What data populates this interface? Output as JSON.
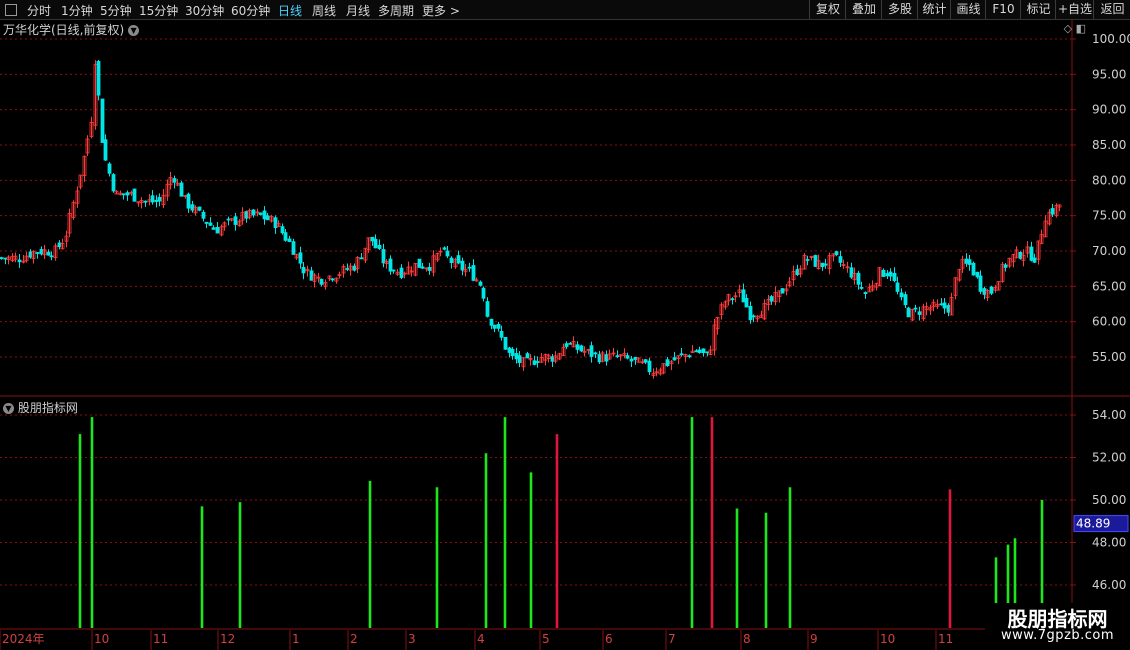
{
  "toolbar": {
    "left": [
      "分时",
      "1分钟",
      "5分钟",
      "15分钟",
      "30分钟",
      "60分钟",
      "日线",
      "周线",
      "月线",
      "多周期",
      "更多 >"
    ],
    "active": "日线",
    "right": [
      "复权",
      "叠加",
      "多股",
      "统计",
      "画线",
      "F10",
      "标记",
      "+自选",
      "返回"
    ]
  },
  "title": "万华化学(日线,前复权)",
  "indicator_title": "股朋指标网",
  "watermark": {
    "name": "股朋指标网",
    "url": "www.7gpzb.com"
  },
  "colors": {
    "up": "#ff3b3b",
    "down": "#00e5e5",
    "grid": "#8a1010",
    "bar_green": "#1ee61e",
    "bar_red": "#e0163c",
    "current_value_box": "#1a1a9a"
  },
  "chart_data": [
    {
      "type": "candlestick",
      "title": "万华化学(日线,前复权)",
      "ylim": [
        52,
        101
      ],
      "yticks": [
        "100.00",
        "95.00",
        "90.00",
        "85.00",
        "80.00",
        "75.00",
        "70.00",
        "65.00",
        "60.00",
        "55.00"
      ],
      "ytick_values": [
        100,
        95,
        90,
        85,
        80,
        75,
        70,
        65,
        60,
        55
      ],
      "grid": true,
      "x_labels": [
        "2024年",
        "10",
        "11",
        "12",
        "1",
        "2",
        "3",
        "4",
        "5",
        "6",
        "7",
        "8",
        "9",
        "10",
        "11"
      ],
      "close_trace": [
        [
          0,
          69
        ],
        [
          20,
          69
        ],
        [
          35,
          70
        ],
        [
          55,
          70
        ],
        [
          65,
          72
        ],
        [
          75,
          78
        ],
        [
          85,
          84
        ],
        [
          95,
          92
        ],
        [
          105,
          83
        ],
        [
          115,
          78
        ],
        [
          130,
          78
        ],
        [
          145,
          77
        ],
        [
          160,
          77
        ],
        [
          172,
          81
        ],
        [
          185,
          77
        ],
        [
          200,
          75
        ],
        [
          215,
          73
        ],
        [
          230,
          74
        ],
        [
          245,
          75
        ],
        [
          260,
          75
        ],
        [
          275,
          74
        ],
        [
          290,
          71
        ],
        [
          305,
          67
        ],
        [
          320,
          66
        ],
        [
          340,
          67
        ],
        [
          355,
          68
        ],
        [
          370,
          72
        ],
        [
          385,
          68
        ],
        [
          400,
          67
        ],
        [
          415,
          68
        ],
        [
          430,
          68
        ],
        [
          440,
          70
        ],
        [
          455,
          68
        ],
        [
          470,
          67
        ],
        [
          482,
          65
        ],
        [
          487,
          61
        ],
        [
          500,
          58
        ],
        [
          510,
          55
        ],
        [
          525,
          54
        ],
        [
          540,
          55
        ],
        [
          555,
          55
        ],
        [
          565,
          57
        ],
        [
          580,
          56
        ],
        [
          600,
          55
        ],
        [
          620,
          55
        ],
        [
          640,
          54
        ],
        [
          652,
          53
        ],
        [
          665,
          54
        ],
        [
          680,
          55
        ],
        [
          695,
          56
        ],
        [
          708,
          55
        ],
        [
          715,
          60
        ],
        [
          725,
          63
        ],
        [
          740,
          64
        ],
        [
          750,
          61
        ],
        [
          765,
          62
        ],
        [
          780,
          64
        ],
        [
          795,
          67
        ],
        [
          805,
          69
        ],
        [
          820,
          68
        ],
        [
          835,
          69
        ],
        [
          850,
          67
        ],
        [
          865,
          64
        ],
        [
          880,
          67
        ],
        [
          890,
          67
        ],
        [
          900,
          63
        ],
        [
          910,
          61
        ],
        [
          925,
          62
        ],
        [
          940,
          62
        ],
        [
          950,
          62
        ],
        [
          958,
          68
        ],
        [
          970,
          68
        ],
        [
          980,
          65
        ],
        [
          990,
          64
        ],
        [
          1000,
          67
        ],
        [
          1010,
          69
        ],
        [
          1025,
          70
        ],
        [
          1035,
          69
        ],
        [
          1045,
          75
        ],
        [
          1055,
          76
        ],
        [
          1063,
          77
        ]
      ]
    },
    {
      "type": "bar",
      "title": "股朋指标网",
      "ylim": [
        44.8,
        54.8
      ],
      "yticks": [
        "54.00",
        "52.00",
        "50.00",
        "48.00",
        "46.00"
      ],
      "ytick_values": [
        54,
        52,
        50,
        48,
        46
      ],
      "current_value": "48.89",
      "baseline": 44.8,
      "bars": [
        {
          "x": 80,
          "value": 53.1,
          "color": "green"
        },
        {
          "x": 92,
          "value": 53.9,
          "color": "green"
        },
        {
          "x": 202,
          "value": 49.7,
          "color": "green"
        },
        {
          "x": 240,
          "value": 49.9,
          "color": "green"
        },
        {
          "x": 370,
          "value": 50.9,
          "color": "green"
        },
        {
          "x": 437,
          "value": 50.6,
          "color": "green"
        },
        {
          "x": 486,
          "value": 52.2,
          "color": "green"
        },
        {
          "x": 505,
          "value": 53.9,
          "color": "green"
        },
        {
          "x": 531,
          "value": 51.3,
          "color": "green"
        },
        {
          "x": 557,
          "value": 53.1,
          "color": "red"
        },
        {
          "x": 692,
          "value": 53.9,
          "color": "green"
        },
        {
          "x": 712,
          "value": 53.9,
          "color": "red"
        },
        {
          "x": 737,
          "value": 49.6,
          "color": "green"
        },
        {
          "x": 766,
          "value": 49.4,
          "color": "green"
        },
        {
          "x": 790,
          "value": 50.6,
          "color": "green"
        },
        {
          "x": 950,
          "value": 50.5,
          "color": "red"
        },
        {
          "x": 996,
          "value": 47.3,
          "color": "green"
        },
        {
          "x": 1008,
          "value": 47.9,
          "color": "green"
        },
        {
          "x": 1015,
          "value": 48.2,
          "color": "green"
        },
        {
          "x": 1042,
          "value": 50.0,
          "color": "green"
        }
      ]
    }
  ]
}
